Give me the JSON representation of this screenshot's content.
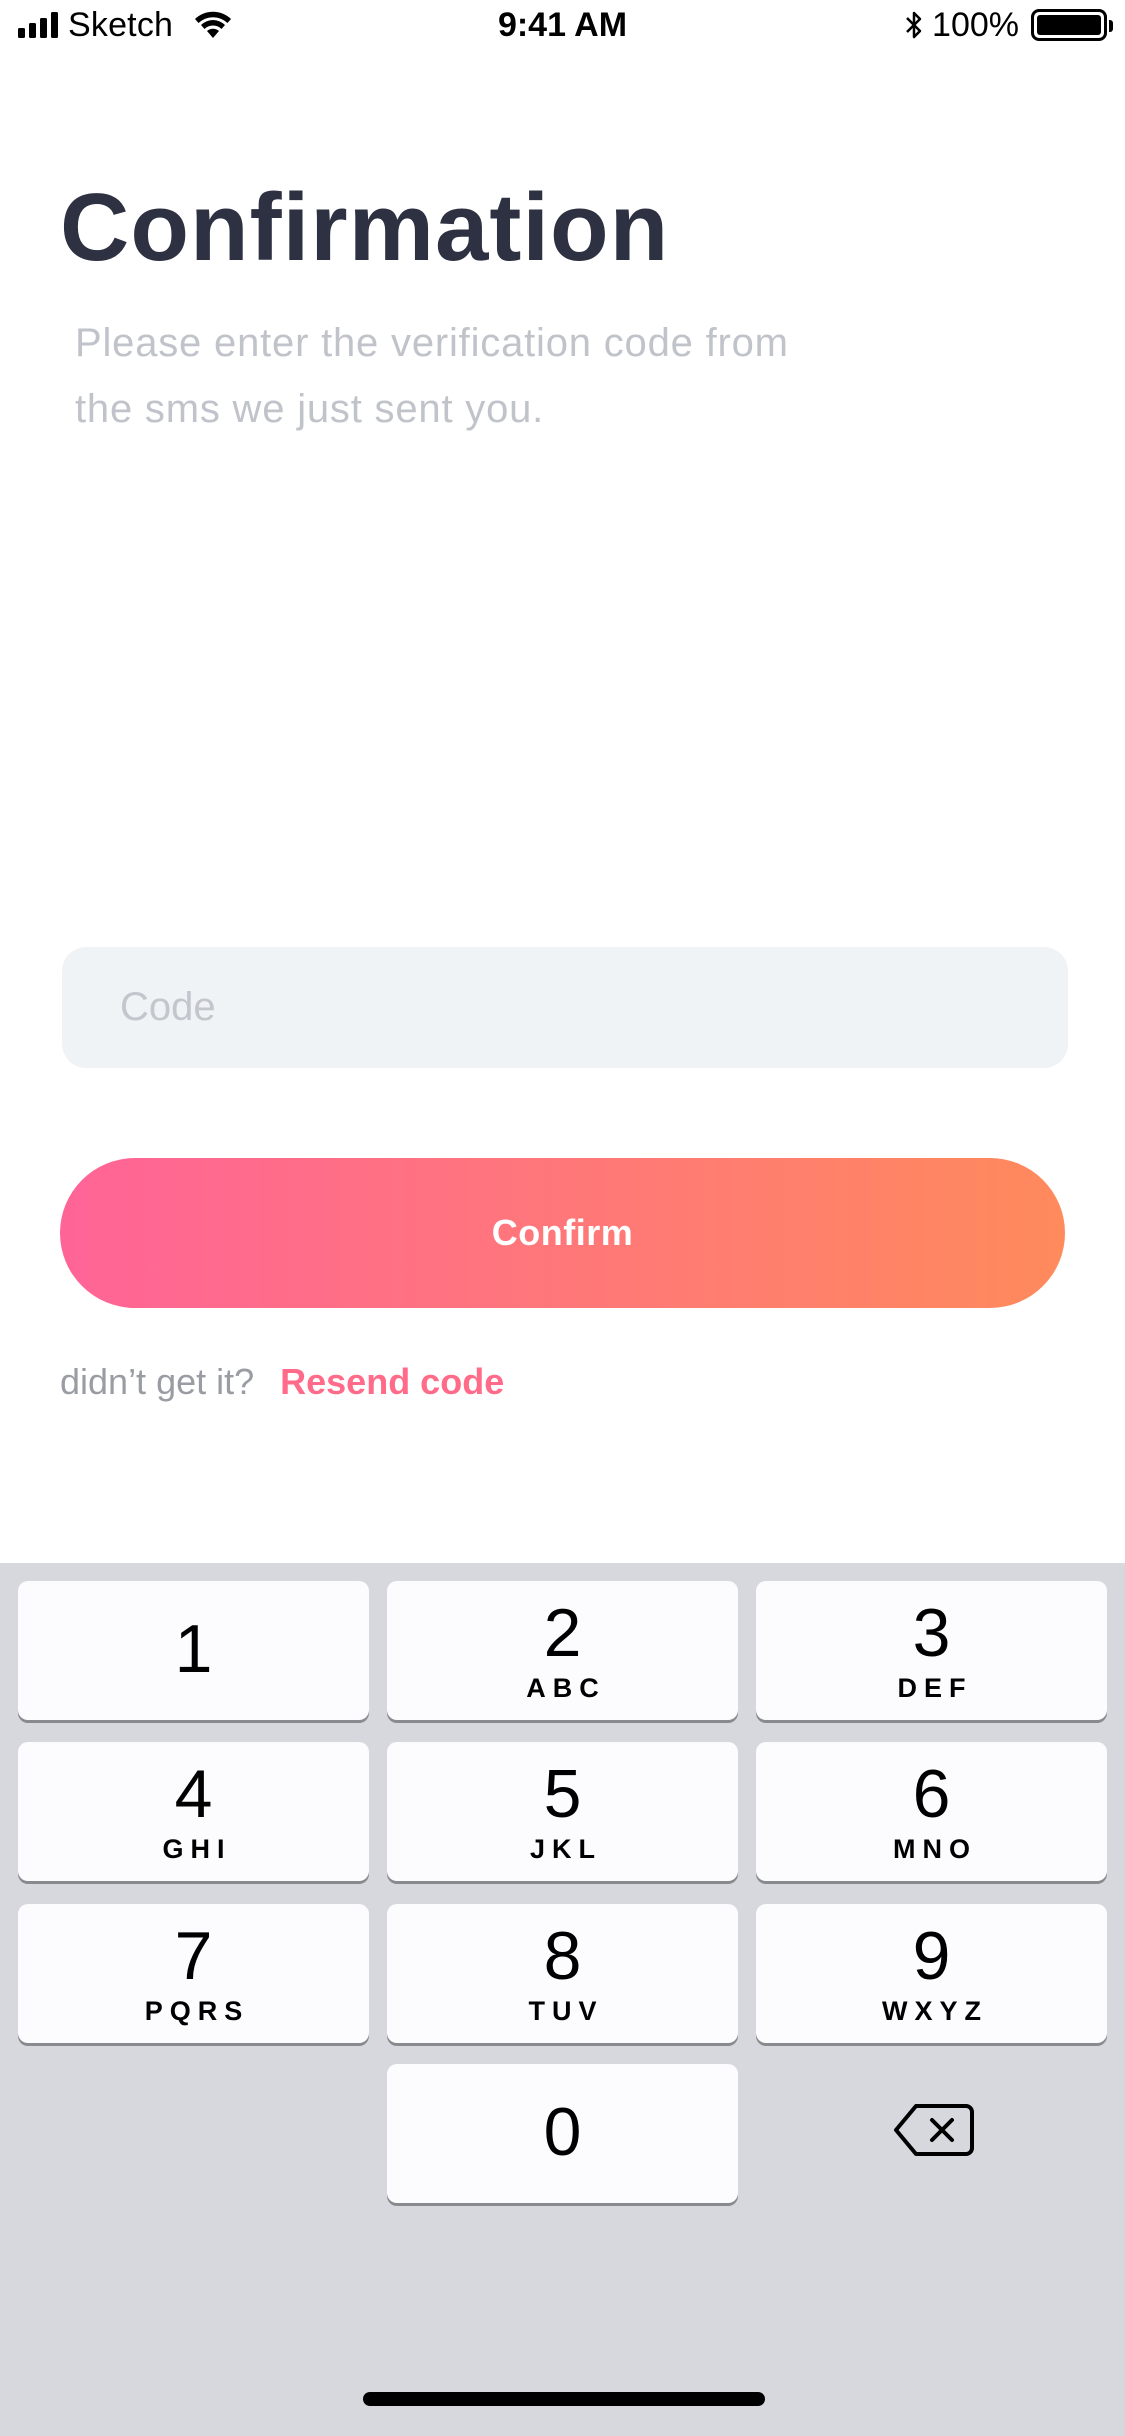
{
  "status_bar": {
    "carrier": "Sketch",
    "time": "9:41 AM",
    "battery_percent": "100%",
    "battery_level": 1.0
  },
  "screen": {
    "title": "Confirmation",
    "subtitle": "Please enter the verification code from the sms we just sent you."
  },
  "code_input": {
    "placeholder": "Code",
    "value": ""
  },
  "confirm_button": {
    "label": "Confirm",
    "gradient_start": "#ff6497",
    "gradient_end": "#ff8a5c"
  },
  "resend": {
    "prompt": "didn’t get it?",
    "link_label": "Resend code",
    "link_color": "#ff6b89"
  },
  "keyboard": {
    "keys": [
      {
        "digit": "1",
        "letters": ""
      },
      {
        "digit": "2",
        "letters": "ABC"
      },
      {
        "digit": "3",
        "letters": "DEF"
      },
      {
        "digit": "4",
        "letters": "GHI"
      },
      {
        "digit": "5",
        "letters": "JKL"
      },
      {
        "digit": "6",
        "letters": "MNO"
      },
      {
        "digit": "7",
        "letters": "PQRS"
      },
      {
        "digit": "8",
        "letters": "TUV"
      },
      {
        "digit": "9",
        "letters": "WXYZ"
      },
      {
        "digit": "0",
        "letters": ""
      }
    ],
    "delete_icon": "backspace-icon"
  }
}
